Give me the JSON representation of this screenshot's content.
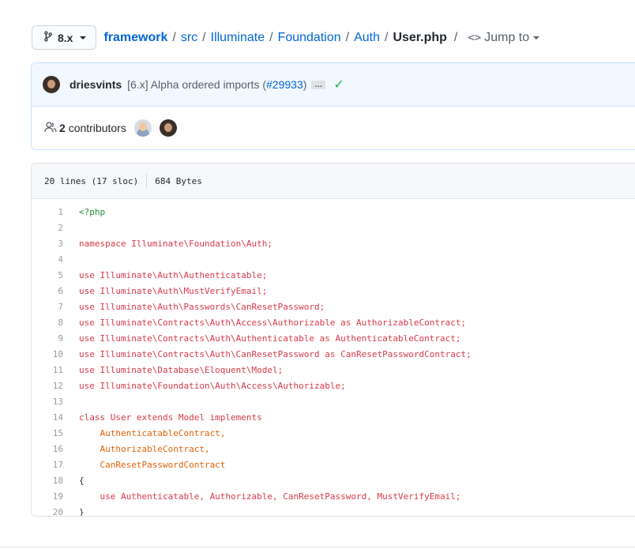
{
  "branch": {
    "label": "8.x",
    "icon": "git-branch-icon"
  },
  "breadcrumb": {
    "root": "framework",
    "parts": [
      "src",
      "Illuminate",
      "Foundation",
      "Auth"
    ],
    "current": "User.php",
    "separator": "/",
    "jump_label": "Jump to"
  },
  "commit": {
    "author": "driesvints",
    "message": "[6.x] Alpha ordered imports (",
    "pr": "#29933",
    "message_end": ")",
    "ellipsis": "…",
    "status": "✓"
  },
  "contributors": {
    "count": "2",
    "label": "contributors"
  },
  "file": {
    "lines_info": "20 lines (17 sloc)",
    "size": "684 Bytes"
  },
  "code_lines": [
    "<?php",
    "",
    "namespace Illuminate\\Foundation\\Auth;",
    "",
    "use Illuminate\\Auth\\Authenticatable;",
    "use Illuminate\\Auth\\MustVerifyEmail;",
    "use Illuminate\\Auth\\Passwords\\CanResetPassword;",
    "use Illuminate\\Contracts\\Auth\\Access\\Authorizable as AuthorizableContract;",
    "use Illuminate\\Contracts\\Auth\\Authenticatable as AuthenticatableContract;",
    "use Illuminate\\Contracts\\Auth\\CanResetPassword as CanResetPasswordContract;",
    "use Illuminate\\Database\\Eloquent\\Model;",
    "use Illuminate\\Foundation\\Auth\\Access\\Authorizable;",
    "",
    "class User extends Model implements",
    "    AuthenticatableContract,",
    "    AuthorizableContract,",
    "    CanResetPasswordContract",
    "{",
    "    use Authenticatable, Authorizable, CanResetPassword, MustVerifyEmail;",
    "}"
  ],
  "colors": {
    "link": "#0366d6",
    "keyword": "#d73a49",
    "tag": "#22863a",
    "success": "#28a745"
  }
}
